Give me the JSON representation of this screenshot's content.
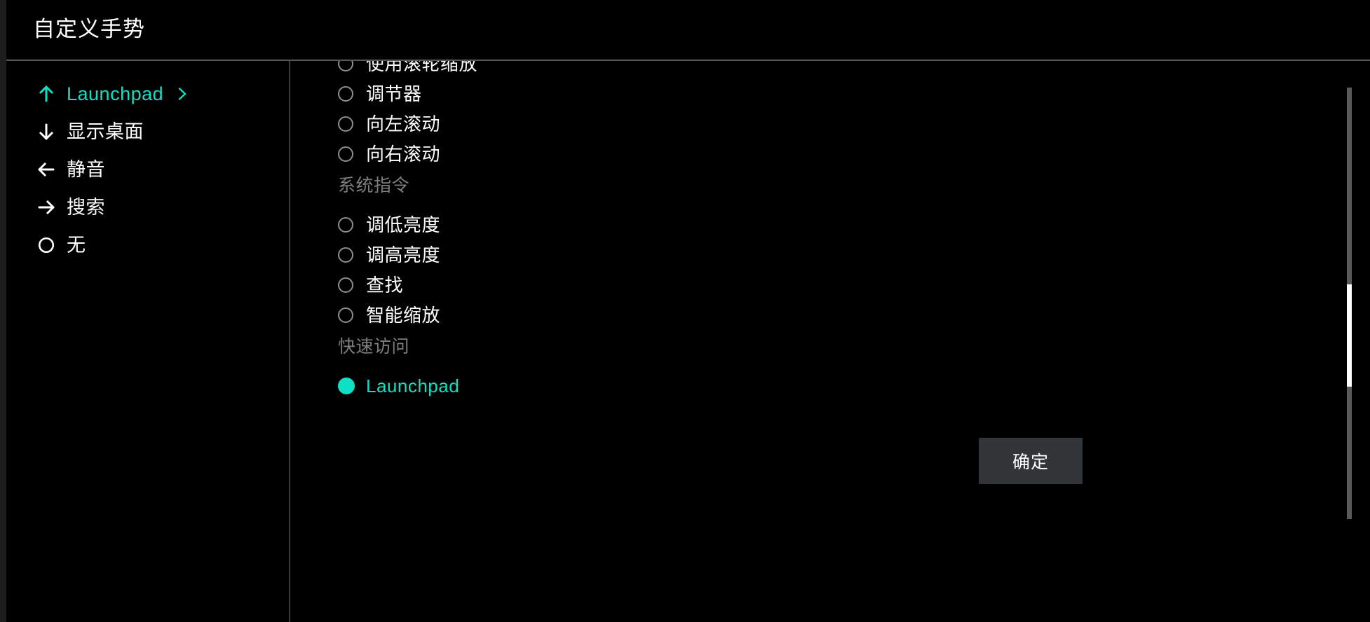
{
  "window": {
    "title": "自定义手势",
    "accent_color": "#0ee0c4",
    "background_color": "#000000",
    "muted_text_color": "#7e7e7e"
  },
  "sidebar": {
    "items": [
      {
        "label": "Launchpad",
        "icon": "arrow-up-icon",
        "selected": true,
        "has_chevron": true
      },
      {
        "label": "显示桌面",
        "icon": "arrow-down-icon",
        "selected": false,
        "has_chevron": false
      },
      {
        "label": "静音",
        "icon": "arrow-left-icon",
        "selected": false,
        "has_chevron": false
      },
      {
        "label": "搜索",
        "icon": "arrow-right-icon",
        "selected": false,
        "has_chevron": false
      },
      {
        "label": "无",
        "icon": "circle-icon",
        "selected": false,
        "has_chevron": false
      }
    ]
  },
  "options": {
    "rows": [
      {
        "type": "option",
        "label": "使用滚轮缩放",
        "selected": false
      },
      {
        "type": "option",
        "label": "调节器",
        "selected": false
      },
      {
        "type": "option",
        "label": "向左滚动",
        "selected": false
      },
      {
        "type": "option",
        "label": "向右滚动",
        "selected": false
      },
      {
        "type": "section",
        "label": "系统指令"
      },
      {
        "type": "option",
        "label": "调低亮度",
        "selected": false
      },
      {
        "type": "option",
        "label": "调高亮度",
        "selected": false
      },
      {
        "type": "option",
        "label": "查找",
        "selected": false
      },
      {
        "type": "option",
        "label": "智能缩放",
        "selected": false
      },
      {
        "type": "section",
        "label": "快速访问"
      },
      {
        "type": "option",
        "label": "Launchpad",
        "selected": true
      }
    ]
  },
  "footer": {
    "confirm_label": "确定"
  }
}
